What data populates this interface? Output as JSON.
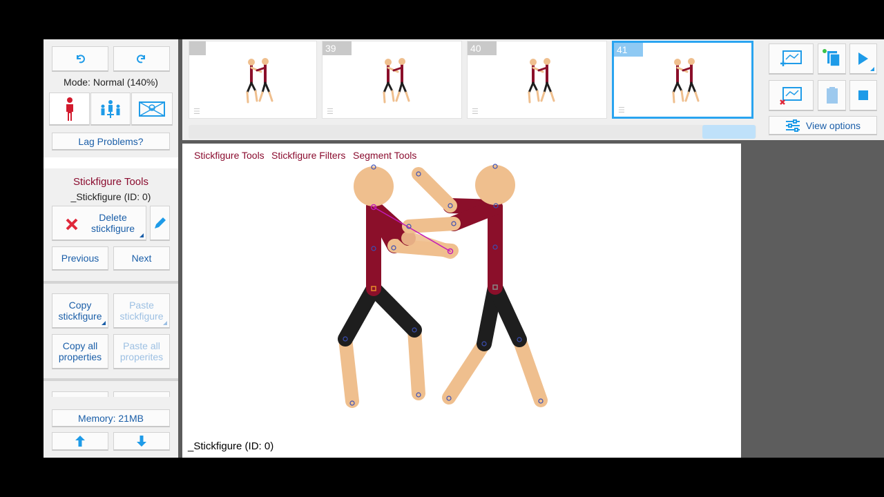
{
  "left_panel": {
    "mode_label": "Mode: Normal (140%)",
    "lag_button": "Lag Problems?",
    "section_title": "Stickfigure Tools",
    "selected_figure": "_Stickfigure (ID: 0)",
    "delete_button": "Delete stickfigure",
    "previous_button": "Previous",
    "next_button": "Next",
    "copy_stickfigure": "Copy stickfigure",
    "paste_stickfigure": "Paste stickfigure",
    "copy_all_properties": "Copy all properties",
    "paste_all_properties": "Paste all properites",
    "memory": "Memory: 21MB"
  },
  "timeline": {
    "frames": [
      {
        "number": ""
      },
      {
        "number": "39"
      },
      {
        "number": "40"
      },
      {
        "number": "41"
      }
    ]
  },
  "right_panel": {
    "view_options": "View options"
  },
  "canvas": {
    "menu": [
      "Stickfigure Tools",
      "Stickfigure Filters",
      "Segment Tools"
    ],
    "status": "_Stickfigure (ID: 0)"
  },
  "colors": {
    "torso": "#8b0f2a",
    "legs": "#1e1e1e",
    "skin": "#efbf8e",
    "accent": "#29a4f0",
    "link": "#1a5ea8",
    "menu_text": "#8a0b2e"
  }
}
